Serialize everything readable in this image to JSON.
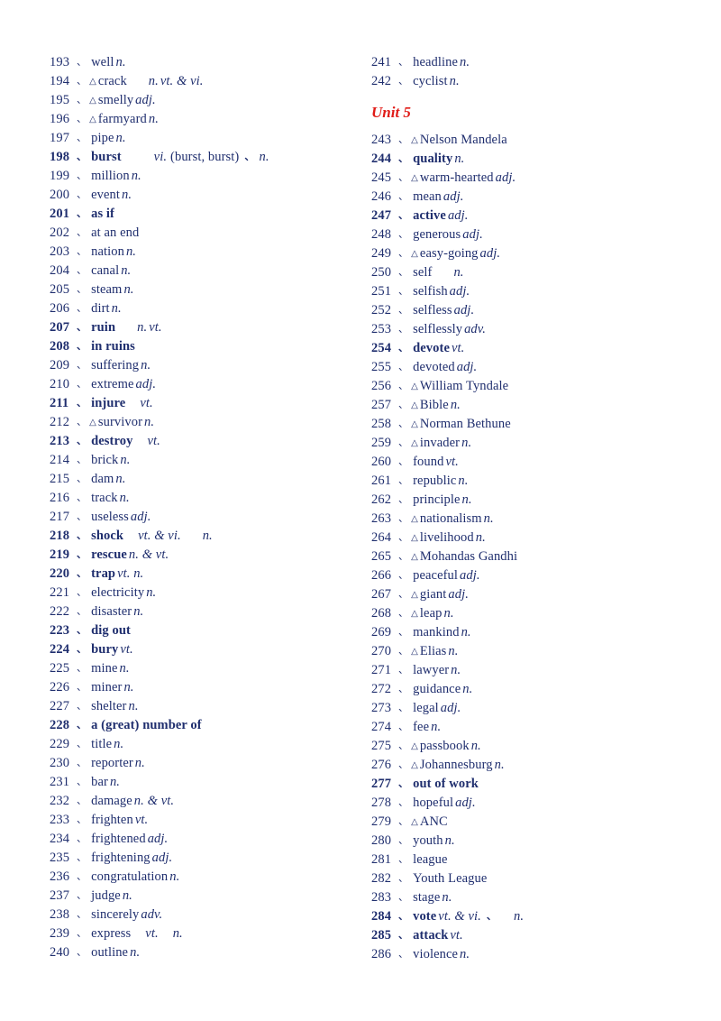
{
  "page": {
    "text_color": "#1f2e6e",
    "unit_heading_color": "#e01b17",
    "background": "#ffffff",
    "marker_triangle": "△"
  },
  "left_column": [
    {
      "num": "193",
      "sep": "、",
      "word": "well",
      "pos": "n.",
      "bold": false
    },
    {
      "num": "194",
      "sep": "、",
      "tri": "△",
      "word": "crack",
      "pos": "n.",
      "gap": "med",
      "pos2": "vt. & vi.",
      "bold": false
    },
    {
      "num": "195",
      "sep": "、",
      "tri": "△",
      "word": "smelly",
      "pos": "adj.",
      "bold": false
    },
    {
      "num": "196",
      "sep": "、",
      "tri": "△",
      "word": "farmyard",
      "pos": "n.",
      "bold": false
    },
    {
      "num": "197",
      "sep": "、",
      "word": "pipe",
      "pos": "n.",
      "bold": false
    },
    {
      "num": "198",
      "sep": "、",
      "word": "burst",
      "pos": "vi.",
      "extra": "(burst, burst)",
      "sep2": "、",
      "gap": "big",
      "pos2": "n.",
      "bold": true
    },
    {
      "num": "199",
      "sep": "、",
      "word": "million",
      "pos": "n.",
      "bold": false
    },
    {
      "num": "200",
      "sep": "、",
      "word": "event",
      "pos": "n.",
      "bold": false
    },
    {
      "num": "201",
      "sep": "、",
      "word": "as if",
      "bold": true
    },
    {
      "num": "202",
      "sep": "、",
      "word": "at an end",
      "bold": false
    },
    {
      "num": "203",
      "sep": "、",
      "word": "nation",
      "pos": "n.",
      "bold": false
    },
    {
      "num": "204",
      "sep": "、",
      "word": "canal",
      "pos": "n.",
      "bold": false
    },
    {
      "num": "205",
      "sep": "、",
      "word": "steam",
      "pos": "n.",
      "bold": false
    },
    {
      "num": "206",
      "sep": "、",
      "word": "dirt",
      "pos": "n.",
      "bold": false
    },
    {
      "num": "207",
      "sep": "、",
      "word": "ruin",
      "pos": "n.",
      "gap": "med",
      "pos2": "vt.",
      "bold": true
    },
    {
      "num": "208",
      "sep": "、",
      "word": "in ruins",
      "bold": true
    },
    {
      "num": "209",
      "sep": "、",
      "word": "suffering",
      "pos": "n.",
      "bold": false
    },
    {
      "num": "210",
      "sep": "、",
      "word": "extreme",
      "pos": "adj.",
      "bold": false
    },
    {
      "num": "211",
      "sep": "、",
      "word": "injure",
      "gap": "small",
      "pos": "vt.",
      "bold": true
    },
    {
      "num": "212",
      "sep": "、",
      "tri": "△",
      "word": "survivor",
      "pos": "n.",
      "bold": false
    },
    {
      "num": "213",
      "sep": "、",
      "word": "destroy",
      "gap": "small",
      "pos": "vt.",
      "bold": true
    },
    {
      "num": "214",
      "sep": "、",
      "word": "brick",
      "pos": "n.",
      "bold": false
    },
    {
      "num": "215",
      "sep": "、",
      "word": "dam",
      "pos": "n.",
      "bold": false
    },
    {
      "num": "216",
      "sep": "、",
      "word": "track",
      "pos": "n.",
      "bold": false
    },
    {
      "num": "217",
      "sep": "、",
      "word": "useless",
      "pos": "adj.",
      "bold": false
    },
    {
      "num": "218",
      "sep": "、",
      "word": "shock",
      "gap": "small",
      "pos": "vt. & vi.",
      "gap2": "med",
      "pos2": "n.",
      "bold": true
    },
    {
      "num": "219",
      "sep": "、",
      "word": "rescue",
      "pos": "n. & vt.",
      "bold": true
    },
    {
      "num": "220",
      "sep": "、",
      "word": "trap",
      "pos": "vt. n.",
      "bold": true
    },
    {
      "num": "221",
      "sep": "、",
      "word": "electricity",
      "pos": "n.",
      "bold": false
    },
    {
      "num": "222",
      "sep": "、",
      "word": "disaster",
      "pos": "n.",
      "bold": false
    },
    {
      "num": "223",
      "sep": "、",
      "word": "dig out",
      "bold": true
    },
    {
      "num": "224",
      "sep": "、",
      "word": "bury",
      "pos": "vt.",
      "bold": true
    },
    {
      "num": "225",
      "sep": "、",
      "word": "mine",
      "pos": "n.",
      "bold": false
    },
    {
      "num": "226",
      "sep": "、",
      "word": "miner",
      "pos": "n.",
      "bold": false
    },
    {
      "num": "227",
      "sep": "、",
      "word": "shelter",
      "pos": "n.",
      "bold": false
    },
    {
      "num": "228",
      "sep": "、",
      "word": "a (great) number of",
      "bold": true
    },
    {
      "num": "229",
      "sep": "、",
      "word": "title",
      "pos": "n.",
      "bold": false
    },
    {
      "num": "230",
      "sep": "、",
      "word": "reporter",
      "pos": "n.",
      "bold": false
    },
    {
      "num": "231",
      "sep": "、",
      "word": "bar",
      "pos": "n.",
      "bold": false
    },
    {
      "num": "232",
      "sep": "、",
      "word": "damage",
      "pos": "n. & vt.",
      "bold": false
    },
    {
      "num": "233",
      "sep": "、",
      "word": "frighten",
      "pos": "vt.",
      "bold": false
    },
    {
      "num": "234",
      "sep": "、",
      "word": "frightened",
      "pos": "adj.",
      "bold": false
    },
    {
      "num": "235",
      "sep": "、",
      "word": "frightening",
      "pos": "adj.",
      "bold": false
    },
    {
      "num": "236",
      "sep": "、",
      "word": "congratulation",
      "pos": "n.",
      "bold": false
    },
    {
      "num": "237",
      "sep": "、",
      "word": "judge",
      "pos": "n.",
      "bold": false
    },
    {
      "num": "238",
      "sep": "、",
      "word": "sincerely",
      "pos": "adv.",
      "bold": false
    },
    {
      "num": "239",
      "sep": "、",
      "word": "express",
      "gap": "small",
      "pos": "vt.",
      "gap2": "small",
      "pos2": "n.",
      "bold": false
    },
    {
      "num": "240",
      "sep": "、",
      "word": "outline",
      "pos": "n.",
      "bold": false
    }
  ],
  "right_column": [
    {
      "num": "241",
      "sep": "、",
      "word": "headline",
      "pos": "n.",
      "bold": false
    },
    {
      "num": "242",
      "sep": "、",
      "word": "cyclist",
      "pos": "n.",
      "bold": false
    },
    {
      "heading": "Unit 5"
    },
    {
      "num": "243",
      "sep": "、",
      "tri": "△",
      "word": "Nelson Mandela",
      "bold": false
    },
    {
      "num": "244",
      "sep": "、",
      "word": "quality",
      "pos": "n.",
      "bold": true
    },
    {
      "num": "245",
      "sep": "、",
      "tri": "△",
      "word": "warm-hearted",
      "pos": "adj.",
      "bold": false
    },
    {
      "num": "246",
      "sep": "、",
      "word": "mean",
      "pos": "adj.",
      "bold": false
    },
    {
      "num": "247",
      "sep": "、",
      "word": "active",
      "pos": "adj.",
      "bold": true
    },
    {
      "num": "248",
      "sep": "、",
      "word": "generous",
      "pos": "adj.",
      "bold": false
    },
    {
      "num": "249",
      "sep": "、",
      "tri": "△",
      "word": "easy-going",
      "pos": "adj.",
      "bold": false
    },
    {
      "num": "250",
      "sep": "、",
      "word": "self",
      "gap": "med",
      "pos": "n.",
      "bold": false
    },
    {
      "num": "251",
      "sep": "、",
      "word": "selfish",
      "pos": "adj.",
      "bold": false
    },
    {
      "num": "252",
      "sep": "、",
      "word": "selfless",
      "pos": "adj.",
      "bold": false
    },
    {
      "num": "253",
      "sep": "、",
      "word": "selflessly",
      "pos": "adv.",
      "bold": false
    },
    {
      "num": "254",
      "sep": "、",
      "word": "devote",
      "pos": "vt.",
      "bold": true
    },
    {
      "num": "255",
      "sep": "、",
      "word": "devoted",
      "pos": "adj.",
      "bold": false
    },
    {
      "num": "256",
      "sep": "、",
      "tri": "△",
      "word": "William Tyndale",
      "bold": false
    },
    {
      "num": "257",
      "sep": "、",
      "tri": "△",
      "word": "Bible",
      "pos": "n.",
      "bold": false
    },
    {
      "num": "258",
      "sep": "、",
      "tri": "△",
      "word": "Norman Bethune",
      "bold": false
    },
    {
      "num": "259",
      "sep": "、",
      "tri": "△",
      "word": "invader",
      "pos": "n.",
      "bold": false
    },
    {
      "num": "260",
      "sep": "、",
      "word": "found",
      "pos": "vt.",
      "bold": false
    },
    {
      "num": "261",
      "sep": "、",
      "word": "republic",
      "pos": "n.",
      "bold": false
    },
    {
      "num": "262",
      "sep": "、",
      "word": "principle",
      "pos": "n.",
      "bold": false
    },
    {
      "num": "263",
      "sep": "、",
      "tri": "△",
      "word": "nationalism",
      "pos": "n.",
      "bold": false
    },
    {
      "num": "264",
      "sep": "、",
      "tri": "△",
      "word": "livelihood",
      "pos": "n.",
      "bold": false
    },
    {
      "num": "265",
      "sep": "、",
      "tri": "△",
      "word": "Mohandas Gandhi",
      "bold": false
    },
    {
      "num": "266",
      "sep": "、",
      "word": "peaceful",
      "pos": "adj.",
      "bold": false
    },
    {
      "num": "267",
      "sep": "、",
      "tri": "△",
      "word": "giant",
      "pos": "adj.",
      "bold": false
    },
    {
      "num": "268",
      "sep": "、",
      "tri": "△",
      "word": "leap",
      "pos": "n.",
      "bold": false
    },
    {
      "num": "269",
      "sep": "、",
      "word": "mankind",
      "pos": "n.",
      "bold": false
    },
    {
      "num": "270",
      "sep": "、",
      "tri": "△",
      "word": "Elias",
      "pos": "n.",
      "bold": false
    },
    {
      "num": "271",
      "sep": "、",
      "word": "lawyer",
      "pos": "n.",
      "bold": false
    },
    {
      "num": "272",
      "sep": "、",
      "word": "guidance",
      "pos": "n.",
      "bold": false
    },
    {
      "num": "273",
      "sep": "、",
      "word": "legal",
      "pos": "adj.",
      "bold": false
    },
    {
      "num": "274",
      "sep": "、",
      "word": "fee",
      "pos": "n.",
      "bold": false
    },
    {
      "num": "275",
      "sep": "、",
      "tri": "△",
      "word": "passbook",
      "pos": "n.",
      "bold": false
    },
    {
      "num": "276",
      "sep": "、",
      "tri": "△",
      "word": "Johannesburg",
      "pos": "n.",
      "bold": false
    },
    {
      "num": "277",
      "sep": "、",
      "word": "out of work",
      "bold": true
    },
    {
      "num": "278",
      "sep": "、",
      "word": "hopeful",
      "pos": "adj.",
      "bold": false
    },
    {
      "num": "279",
      "sep": "、",
      "tri": "△",
      "word": "ANC",
      "bold": false
    },
    {
      "num": "280",
      "sep": "、",
      "word": "youth",
      "pos": "n.",
      "bold": false
    },
    {
      "num": "281",
      "sep": "、",
      "word": "league",
      "bold": false
    },
    {
      "num": "282",
      "sep": "、",
      "word": "Youth League",
      "bold": false
    },
    {
      "num": "283",
      "sep": "、",
      "word": "stage",
      "pos": "n.",
      "bold": false
    },
    {
      "num": "284",
      "sep": "、",
      "word": "vote",
      "pos": "vt. & vi.",
      "sep2": "、",
      "gap2": "small",
      "pos2": "n.",
      "bold": true
    },
    {
      "num": "285",
      "sep": "、",
      "word": "attack",
      "pos": "vt.",
      "bold": true
    },
    {
      "num": "286",
      "sep": "、",
      "word": "violence",
      "pos": "n.",
      "bold": false
    }
  ]
}
